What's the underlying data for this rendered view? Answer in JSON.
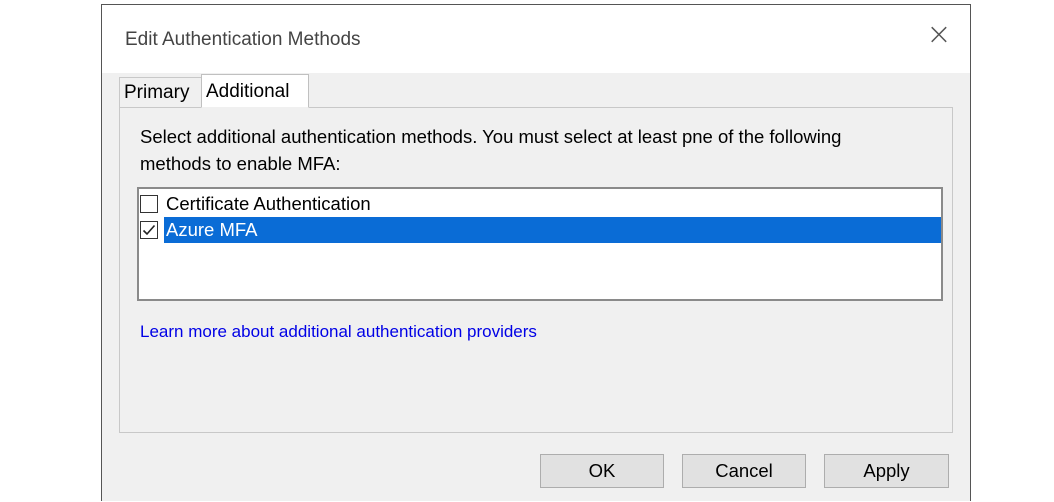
{
  "dialog": {
    "title": "Edit Authentication Methods",
    "close_glyph": "×"
  },
  "tabs": [
    {
      "label": "Primary",
      "selected": false
    },
    {
      "label": "Additional",
      "selected": true
    }
  ],
  "panel": {
    "description": "Select additional authentication methods. You must select at least pne of the following methods to enable MFA:",
    "methods": [
      {
        "label": "Certificate Authentication",
        "checked": false,
        "selected": false
      },
      {
        "label": "Azure MFA",
        "checked": true,
        "selected": true
      }
    ],
    "link_text": "Learn more about additional authentication providers"
  },
  "buttons": {
    "ok": "OK",
    "cancel": "Cancel",
    "apply": "Apply"
  },
  "colors": {
    "selection": "#0a6cd6",
    "link": "#0000e6",
    "dialog_bg": "#f0f0f0"
  },
  "icons": {
    "close": "close-icon",
    "check": "checkmark-icon"
  }
}
